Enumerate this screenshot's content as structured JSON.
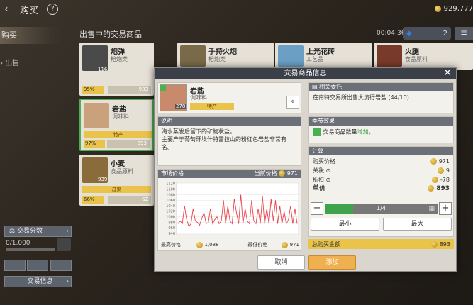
{
  "header": {
    "title": "购买",
    "gold": "929,777"
  },
  "sidebar": {
    "buy": "购买",
    "sell": "出售"
  },
  "section_title": "出售中的交易商品",
  "timer": "00:04:36",
  "timer_count": "2",
  "cards": [
    {
      "name": "炮弹",
      "cat": "枪炮类",
      "qty": "116",
      "pct": "95%",
      "price": "933"
    },
    {
      "name": "手持火炮",
      "cat": "枪炮类",
      "qty": "",
      "pct": "",
      "price": ""
    },
    {
      "name": "上光花砖",
      "cat": "工艺品",
      "qty": "",
      "pct": "",
      "price": ""
    },
    {
      "name": "火腿",
      "cat": "食品原料",
      "qty": "",
      "pct": "",
      "price": ""
    },
    {
      "name": "岩盐",
      "cat": "调味料",
      "qty": "278",
      "pct": "97%",
      "price": "893",
      "tag": "特产"
    },
    {
      "name": "小麦",
      "cat": "食品原料",
      "qty": "939",
      "pct": "66%",
      "price": "62",
      "tag": "过剩"
    }
  ],
  "bottom": {
    "score_label": "交易分数",
    "score_value": "0/1,000",
    "trade_info": "交易信息"
  },
  "modal": {
    "title": "交易商品信息",
    "item": {
      "name": "岩盐",
      "cat": "调味料",
      "qty": "278",
      "tag": "特产"
    },
    "desc_h": "说明",
    "desc": "海水蒸发后留下的矿物状盐。\n主要产于葡萄牙埃什特雷拉山的粉红色岩盐非常有名。",
    "market_h": "市场价格",
    "current_label": "当前价格",
    "current_value": "971",
    "max_label": "最高价格",
    "max_value": "1,088",
    "min_label": "最低价格",
    "min_value": "971",
    "quest_h": "相关委托",
    "quest_text": "在南特交易所出售大流行岩盐 (44/10)",
    "season_h": "季节效果",
    "season_text": "交易商品数量",
    "season_hl": "增加",
    "calc_h": "计算",
    "calc_rows": [
      {
        "l": "购买价格",
        "v": "971"
      },
      {
        "l": "关税",
        "v": "9"
      },
      {
        "l": "折扣",
        "v": "-78"
      },
      {
        "l": "单价",
        "v": "893"
      }
    ],
    "stepper": {
      "minus": "−",
      "value": "1/4",
      "plus": "+"
    },
    "min_btn": "最小",
    "max_btn": "最大",
    "total_label": "总购买金额",
    "total_value": "893",
    "cancel": "取消",
    "add": "添加"
  },
  "chart_data": {
    "type": "line",
    "yticks": [
      "1120",
      "1100",
      "1080",
      "1060",
      "1040",
      "1020",
      "1000",
      "980",
      "960",
      "940"
    ],
    "ylim": [
      935,
      1125
    ],
    "values": [
      975,
      985,
      975,
      1040,
      990,
      965,
      975,
      1030,
      985,
      980,
      970,
      995,
      1015,
      975,
      980,
      1030,
      975,
      990,
      1000,
      975,
      985,
      1060,
      975,
      1040,
      985,
      975,
      1065,
      1015,
      975,
      1080,
      975,
      1030,
      985,
      975,
      1060,
      985,
      975,
      1030,
      975,
      1075,
      975,
      1030,
      975,
      1065,
      985,
      1060,
      975,
      1040,
      975,
      1020,
      975,
      990,
      1040,
      975,
      1030,
      975
    ]
  }
}
